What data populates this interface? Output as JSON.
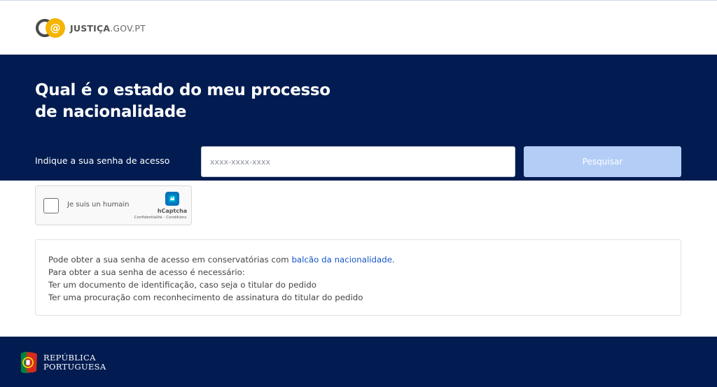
{
  "header": {
    "logo_brand": "JUSTIÇA",
    "logo_domain": ".GOV.PT"
  },
  "hero": {
    "title": "Qual é o estado do meu processo de nacionalidade",
    "field_label": "Indique a sua senha de acesso",
    "input_placeholder": "xxxx-xxxx-xxxx",
    "input_value": "",
    "search_button": "Pesquisar",
    "colors": {
      "background": "#021c51",
      "button_disabled": "#b3cdf7"
    }
  },
  "captcha": {
    "checkbox_label": "Je suis un humain",
    "provider": "hCaptcha",
    "privacy_link": "Confidentialité",
    "separator": " - ",
    "terms_link": "Conditions"
  },
  "info": {
    "line1_text": "Pode obter a sua senha de acesso em conservatórias com ",
    "line1_link": "balcão da nacionalidade",
    "line1_end": ".",
    "line2": "Para obter a sua senha de acesso é necessário:",
    "line3": "Ter um documento de identificação, caso seja o titular do pedido",
    "line4": "Ter uma procuração com reconhecimento de assinatura do titular do pedido"
  },
  "footer": {
    "line1": "REPÚBLICA",
    "line2": "PORTUGUESA"
  }
}
